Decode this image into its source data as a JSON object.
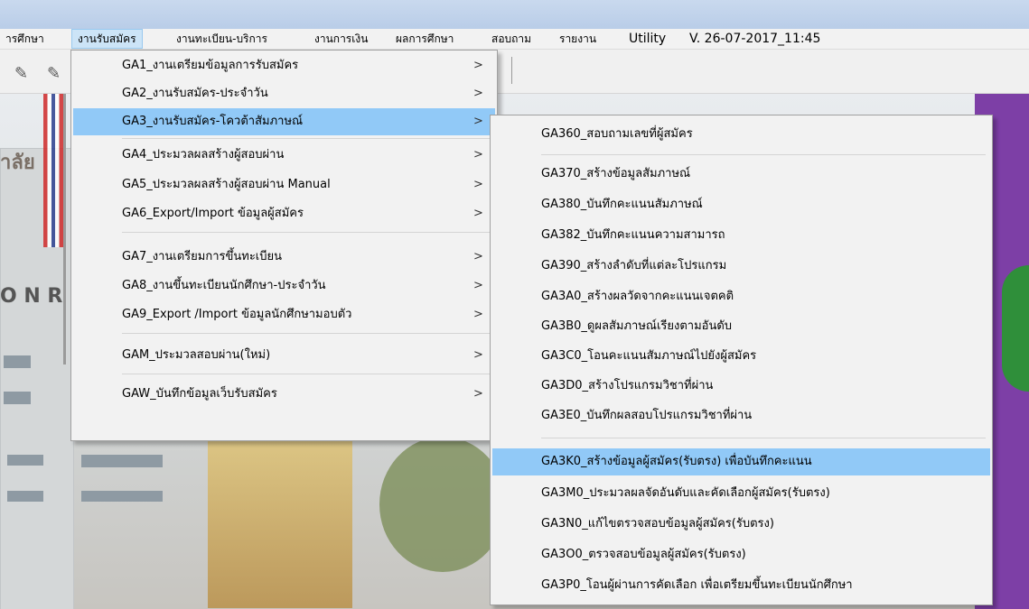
{
  "menubar": {
    "items": [
      {
        "label": "ารศึกษา"
      },
      {
        "label": "งานรับสมัคร"
      },
      {
        "label": "งานทะเบียน-บริการ"
      },
      {
        "label": "งานการเงิน"
      },
      {
        "label": "ผลการศึกษา"
      },
      {
        "label": "สอบถาม"
      },
      {
        "label": "รายงาน"
      },
      {
        "label": "Utility"
      },
      {
        "label": "V. 26-07-2017_11:45"
      }
    ]
  },
  "background": {
    "text_left": "าลัย",
    "text_sign": "O N R"
  },
  "menu": {
    "items": [
      {
        "label": "GA1_งานเตรียมข้อมูลการรับสมัคร"
      },
      {
        "label": "GA2_งานรับสมัคร-ประจำวัน"
      },
      {
        "label": "GA3_งานรับสมัคร-โควต้าสัมภาษณ์"
      },
      {
        "label": "GA4_ประมวลผลสร้างผู้สอบผ่าน"
      },
      {
        "label": "GA5_ประมวลผลสร้างผู้สอบผ่าน Manual"
      },
      {
        "label": "GA6_Export/Import ข้อมูลผู้สมัคร"
      },
      {
        "label": "GA7_งานเตรียมการขึ้นทะเบียน"
      },
      {
        "label": "GA8_งานขึ้นทะเบียนนักศึกษา-ประจำวัน"
      },
      {
        "label": "GA9_Export /Import ข้อมูลนักศึกษามอบตัว"
      },
      {
        "label": "GAM_ประมวลสอบผ่าน(ใหม่)"
      },
      {
        "label": "GAW_บันทึกข้อมูลเว็บรับสมัคร"
      }
    ],
    "arrow": ">"
  },
  "submenu": {
    "items": [
      {
        "label": "GA360_สอบถามเลขที่ผู้สมัคร"
      },
      {
        "label": "GA370_สร้างข้อมูลสัมภาษณ์"
      },
      {
        "label": "GA380_บันทึกคะแนนสัมภาษณ์"
      },
      {
        "label": "GA382_บันทึกคะแนนความสามารถ"
      },
      {
        "label": "GA390_สร้างลำดับที่แต่ละโปรแกรม"
      },
      {
        "label": "GA3A0_สร้างผลวัดจากคะแนนเจตคติ"
      },
      {
        "label": "GA3B0_ดูผลสัมภาษณ์เรียงตามอันดับ"
      },
      {
        "label": "GA3C0_โอนคะแนนสัมภาษณ์ไปยังผู้สมัคร"
      },
      {
        "label": "GA3D0_สร้างโปรแกรมวิชาที่ผ่าน"
      },
      {
        "label": "GA3E0_บันทึกผลสอบโปรแกรมวิชาที่ผ่าน"
      },
      {
        "label": "GA3K0_สร้างข้อมูลผู้สมัคร(รับตรง) เพื่อบันทึกคะแนน"
      },
      {
        "label": "GA3M0_ประมวลผลจัดอันดับและคัดเลือกผู้สมัคร(รับตรง)"
      },
      {
        "label": "GA3N0_แก้ไขตรวจสอบข้อมูลผู้สมัคร(รับตรง)"
      },
      {
        "label": "GA3O0_ตรวจสอบข้อมูลผู้สมัคร(รับตรง)"
      },
      {
        "label": "GA3P0_โอนผู้ผ่านการคัดเลือก เพื่อเตรียมขึ้นทะเบียนนักศึกษา"
      }
    ]
  },
  "colors": {
    "highlight": "#91c9f7",
    "menubar_active": "#cce4f7"
  }
}
